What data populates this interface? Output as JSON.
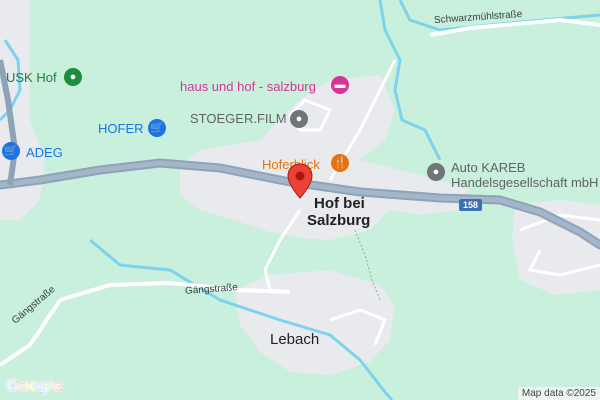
{
  "map": {
    "pois": {
      "usk_hof": {
        "label": "USK Hof",
        "icon": "pin-icon"
      },
      "hofer": {
        "label": "HOFER",
        "icon": "shopping-cart-icon"
      },
      "adeg": {
        "label": "ADEG",
        "icon": "shopping-cart-icon"
      },
      "haus_und_hof": {
        "label": "haus und hof - salzburg",
        "icon": "hotel-bed-icon"
      },
      "stoeger_film": {
        "label": "STOEGER.FILM",
        "icon": "pin-icon"
      },
      "hofer_blick": {
        "label": "Hoferblick",
        "icon": "restaurant-icon"
      },
      "auto_kareb_line1": {
        "label": "Auto KAREB",
        "icon": "pin-icon"
      },
      "auto_kareb_line2": {
        "label": "Handelsgesellschaft mbH"
      }
    },
    "places": {
      "hof_line1": "Hof bei",
      "hof_line2": "Salzburg",
      "lebach": "Lebach"
    },
    "streets": {
      "schwarzmuehl": "Schwarzmühlstraße",
      "gaengstrasse_1": "Gängstraße",
      "gaengstrasse_2": "Gängstraße"
    },
    "road_shield": "158",
    "attribution": "Map data ©2025",
    "logo_text": "Google",
    "colors": {
      "land": "#c8f0dc",
      "built_area": "#e8eaed",
      "highway": "#8ea3b8",
      "water": "#7dd3ec",
      "marker": "#ea4335",
      "blue_poi": "#1a73e8",
      "pink_poi": "#d93399",
      "orange_poi": "#e8710a"
    }
  }
}
